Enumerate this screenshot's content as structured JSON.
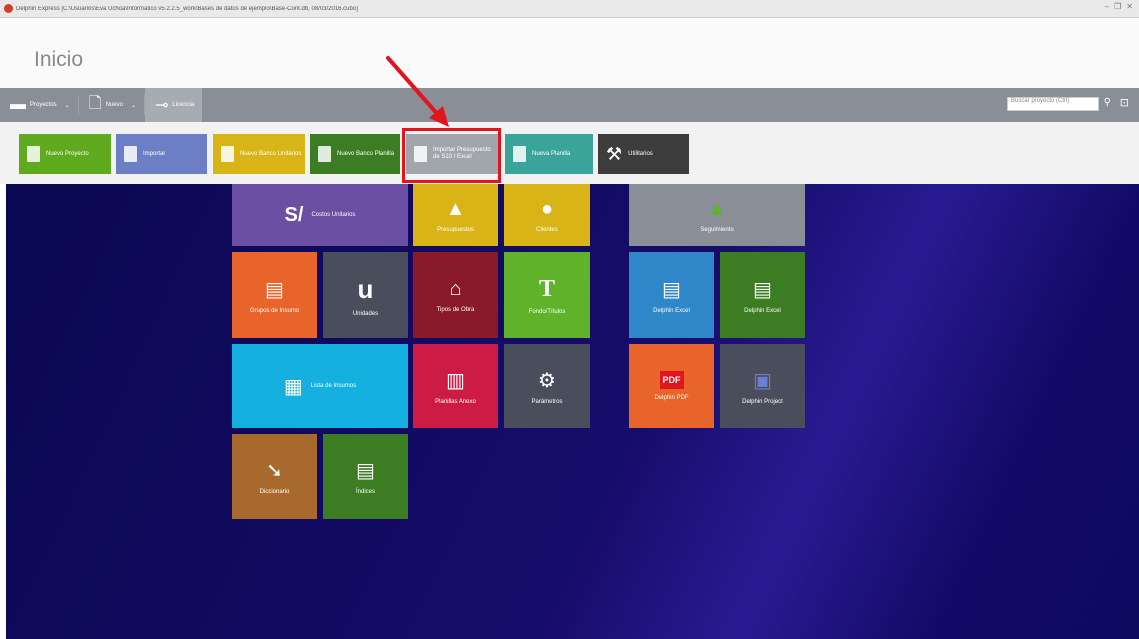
{
  "window": {
    "title": "Delphin Express [C:\\Usuarios\\Eva Uchoa\\Informatico v5.2.2.5_work\\Bases de datos de ejemplo\\Base-Cont.db, 08/03/2016.cubo]",
    "controls": [
      "–",
      "❐",
      "✕"
    ]
  },
  "header": {
    "title": "Inicio"
  },
  "toolbar": {
    "items": [
      {
        "label": "Proyectos",
        "icon": "folder-icon"
      },
      {
        "label": "Nuevo",
        "icon": "new-document-icon"
      },
      {
        "label": "Licencia",
        "icon": "key-icon"
      }
    ],
    "search_placeholder": "Buscar proyecto (Ctrl)"
  },
  "ribbon": {
    "buttons": [
      {
        "label": "Nuevo Proyecto",
        "color": "#5faa1e"
      },
      {
        "label": "Importar",
        "color": "#6c7fc4"
      },
      {
        "label": "Nuevo Banco Unitarios",
        "color": "#d8b416"
      },
      {
        "label": "Nuevo Banco Planilla",
        "color": "#3c7d23"
      },
      {
        "label": "Importar Presupuesto de S10 / Excel",
        "color": "#a1a6ad"
      },
      {
        "label": "Nueva Planilla",
        "color": "#3aa49a"
      },
      {
        "label": "Utilitarios",
        "color": "#3d3d3d"
      }
    ]
  },
  "tiles": {
    "costos_unitarios": {
      "label": "Costos Unitarios",
      "icon": "S/",
      "color": "#6a4fa3"
    },
    "presupuestos": {
      "label": "Presupuestos",
      "icon": "▲",
      "color": "#d8b416"
    },
    "clientes": {
      "label": "Clientes",
      "icon": "●",
      "color": "#d8b416"
    },
    "seguimiento": {
      "label": "Seguimiento",
      "icon": "▲",
      "color": "#8a8e96"
    },
    "grupos_insumo": {
      "label": "Grupos de Insumo",
      "icon": "▤",
      "color": "#e8642a"
    },
    "unidades": {
      "label": "Unidades",
      "icon": "u",
      "color": "#4a4e5c"
    },
    "tipos_obra": {
      "label": "Tipos de Obra",
      "icon": "⌂",
      "color": "#8a1a2a"
    },
    "fondo_titulos": {
      "label": "Fondo/Títulos",
      "icon": "T",
      "color": "#5fb22a"
    },
    "delphin_excel_1": {
      "label": "Delphin Excel",
      "icon": "▤",
      "color": "#2f86c8"
    },
    "delphin_excel_2": {
      "label": "Delphin Excel",
      "icon": "▤",
      "color": "#3c7d23"
    },
    "lista_insumos": {
      "label": "Lista de Insumos",
      "icon": "▦",
      "color": "#13b0e0"
    },
    "planillas_anexo": {
      "label": "Planillas Anexo",
      "icon": "▥",
      "color": "#cc1c45"
    },
    "parametros": {
      "label": "Parámetros",
      "icon": "⚙",
      "color": "#4a4e5c"
    },
    "delphin_pdf": {
      "label": "Delphin PDF",
      "icon": "PDF",
      "color": "#e8642a"
    },
    "delphin_project": {
      "label": "Delphin Project",
      "icon": "▣",
      "color": "#4a4e5c"
    },
    "diccionario": {
      "label": "Diccionario",
      "icon": "➘",
      "color": "#a86a2c"
    },
    "indices": {
      "label": "Índices",
      "icon": "▤",
      "color": "#3c7d23"
    }
  }
}
